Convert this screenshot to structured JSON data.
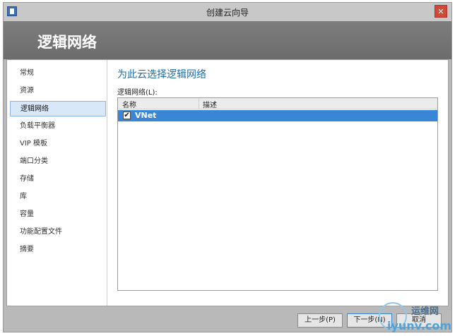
{
  "window": {
    "title": "创建云向导",
    "close_glyph": "✕"
  },
  "header": {
    "title": "逻辑网络"
  },
  "sidebar": {
    "items": [
      {
        "label": "常规"
      },
      {
        "label": "资源"
      },
      {
        "label": "逻辑网络",
        "active": true
      },
      {
        "label": "负载平衡器"
      },
      {
        "label": "VIP 模板"
      },
      {
        "label": "端口分类"
      },
      {
        "label": "存储"
      },
      {
        "label": "库"
      },
      {
        "label": "容量"
      },
      {
        "label": "功能配置文件"
      },
      {
        "label": "摘要"
      }
    ]
  },
  "main": {
    "heading": "为此云选择逻辑网络",
    "field_label": "逻辑网络(L):",
    "columns": [
      "名称",
      "描述"
    ],
    "rows": [
      {
        "checked": true,
        "check_glyph": "✔",
        "name": "VNet",
        "description": ""
      }
    ]
  },
  "footer": {
    "prev_label": "上一步(P)",
    "next_label": "下一步(N)",
    "cancel_label": "取消"
  },
  "watermark": {
    "cn": "运维网",
    "en": "iyunv.com"
  },
  "colors": {
    "accent": "#1b6ea8",
    "selection": "#3a86d6",
    "header_bg": "#757575"
  },
  "icons": [
    "app-icon",
    "close-icon",
    "checkbox-checked-icon"
  ]
}
